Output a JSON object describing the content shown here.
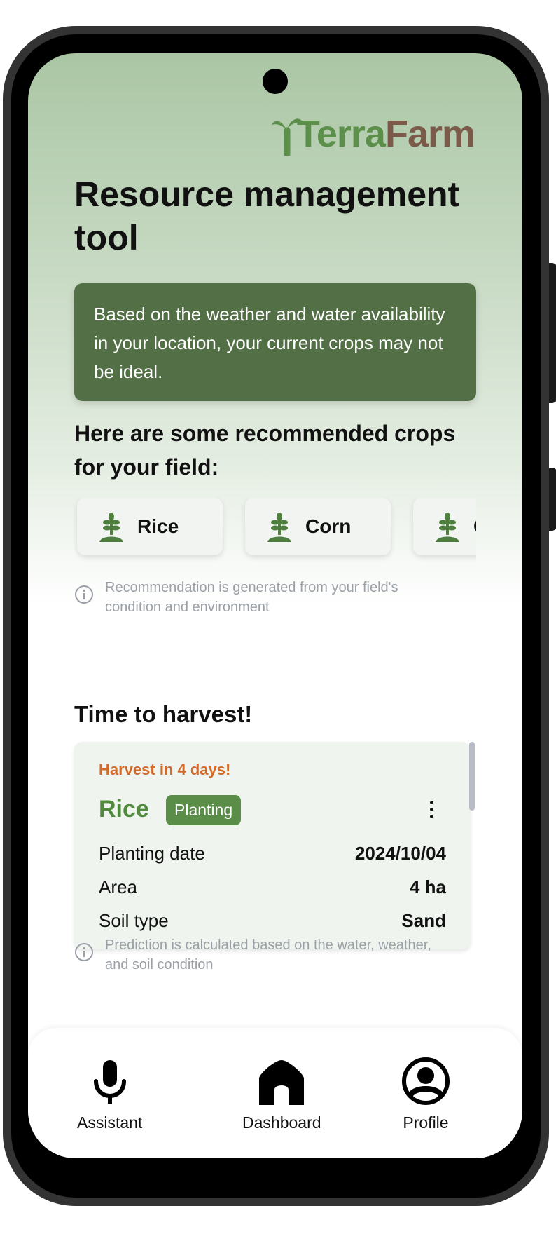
{
  "app": {
    "logo_part1": "Terra",
    "logo_part2": "Farm"
  },
  "page": {
    "title": "Resource management tool"
  },
  "alert": {
    "text": "Based on the weather and water availability in your location, your current crops may not be ideal."
  },
  "recommendations": {
    "heading": "Here are some recommended crops for your field:",
    "items": [
      {
        "label": "Rice",
        "icon": "sprout-icon"
      },
      {
        "label": "Corn",
        "icon": "sprout-icon"
      },
      {
        "label": "C",
        "icon": "sprout-icon"
      }
    ],
    "note": "Recommendation is generated from your field's condition and environment"
  },
  "harvest": {
    "heading": "Time to harvest!",
    "card": {
      "due": "Harvest in 4 days!",
      "crop": "Rice",
      "status": "Planting",
      "rows": [
        {
          "label": "Planting date",
          "value": "2024/10/04"
        },
        {
          "label": "Area",
          "value": "4 ha"
        },
        {
          "label": "Soil type",
          "value": "Sand"
        }
      ]
    },
    "note": "Prediction is calculated based on the water, weather, and soil condition"
  },
  "nav": {
    "items": [
      {
        "label": "Assistant",
        "icon": "microphone-icon"
      },
      {
        "label": "Dashboard",
        "icon": "home-icon"
      },
      {
        "label": "Profile",
        "icon": "profile-icon"
      }
    ]
  },
  "colors": {
    "brand_green": "#5b8f4a",
    "brand_brown": "#7b5a4a",
    "alert_bg": "#526f45",
    "harvest_orange": "#d36a2a"
  }
}
